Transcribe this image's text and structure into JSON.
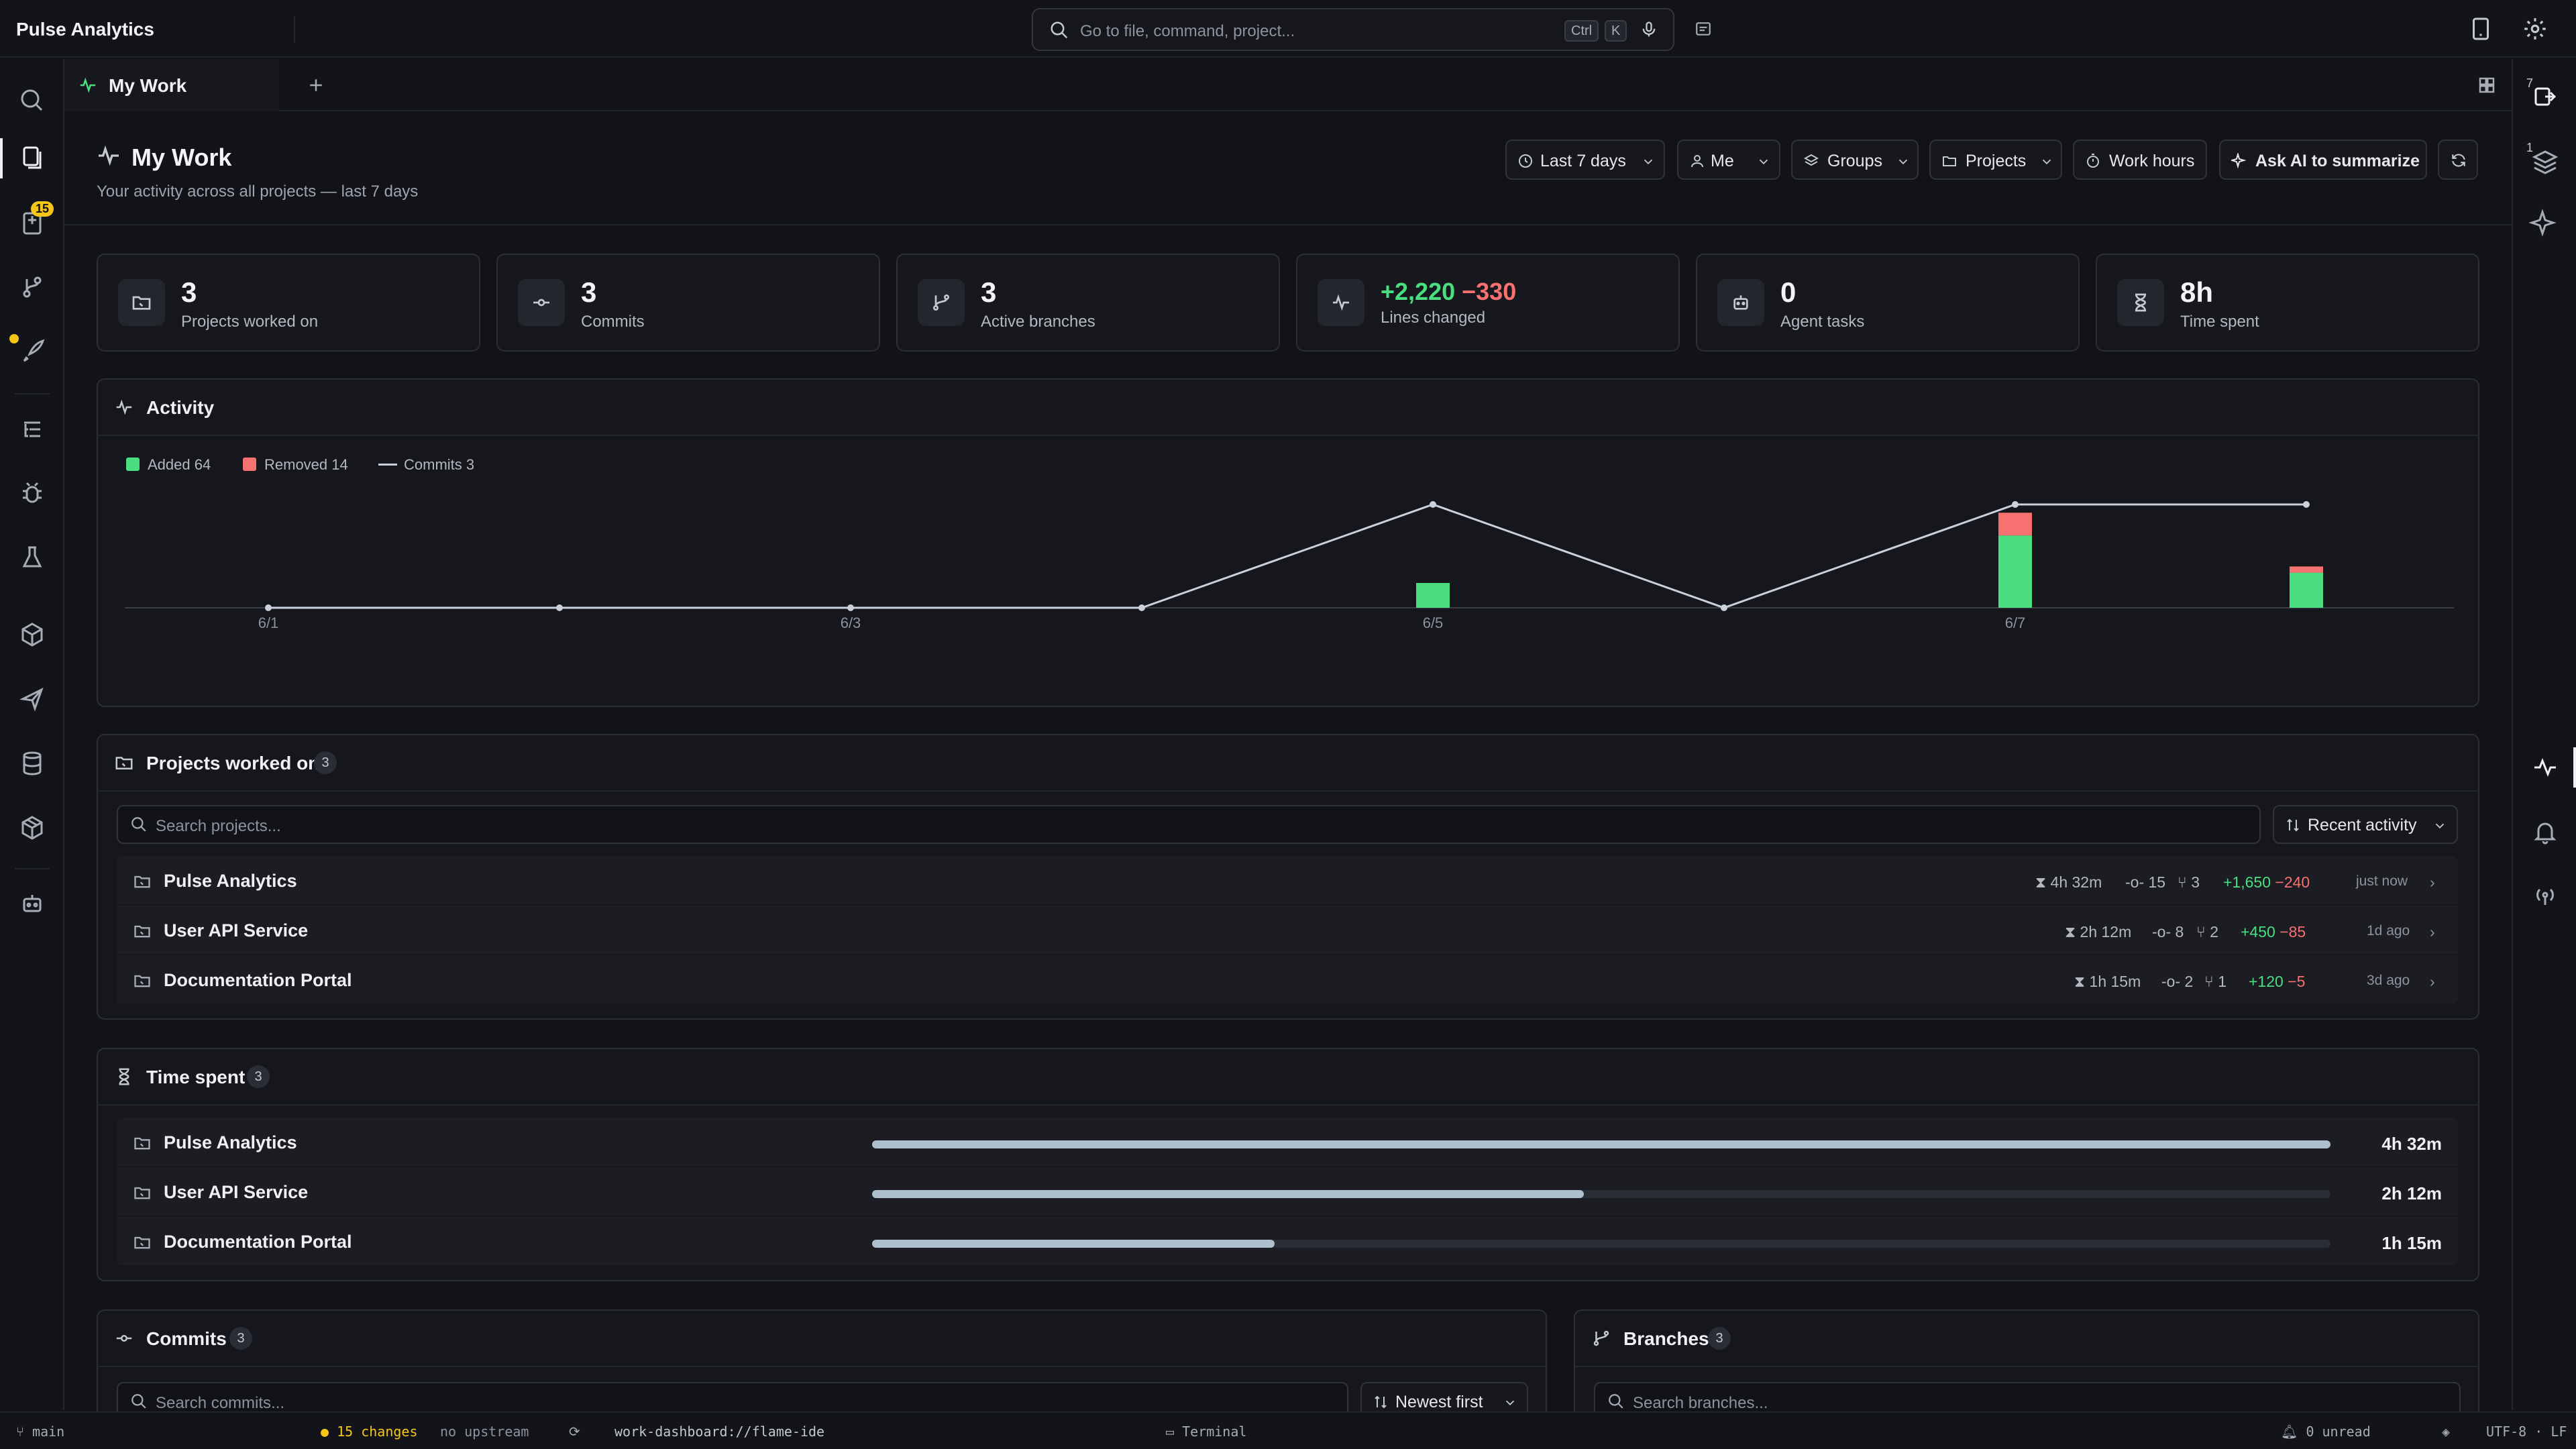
{
  "app": {
    "title": "Pulse Analytics"
  },
  "command_bar": {
    "placeholder": "Go to file, command, project...",
    "shortcut_ctrl": "Ctrl",
    "shortcut_key": "K"
  },
  "activity_bar": {
    "badge": "15",
    "right_badges": [
      "7",
      "1"
    ]
  },
  "tabs": [
    {
      "label": "My Work"
    }
  ],
  "page": {
    "title": "My Work",
    "subtitle": "Your activity across all projects — last 7 days",
    "filters": {
      "range": "Last 7 days",
      "user": "Me",
      "groups": "Groups",
      "projects": "Projects",
      "work_hours": "Work hours",
      "ai": "Ask AI to summarize"
    }
  },
  "stats": [
    {
      "value": "3",
      "label": "Projects worked on",
      "icon": "folder-icon"
    },
    {
      "value": "3",
      "label": "Commits",
      "icon": "commit-icon"
    },
    {
      "value": "3",
      "label": "Active branches",
      "icon": "branch-icon"
    },
    {
      "value_added": "+2,220",
      "value_removed": "−330",
      "label": "Lines changed",
      "icon": "pulse-icon"
    },
    {
      "value": "0",
      "label": "Agent tasks",
      "icon": "robot-icon"
    },
    {
      "value": "8h",
      "label": "Time spent",
      "icon": "hourglass-icon"
    }
  ],
  "activity": {
    "title": "Activity",
    "legend": {
      "added": "Added 64",
      "removed": "Removed 14",
      "commits": "Commits 3"
    }
  },
  "chart_data": {
    "type": "bar",
    "x": [
      "6/1",
      "6/2",
      "6/3",
      "6/4",
      "6/5",
      "6/6",
      "6/7",
      "6/8"
    ],
    "tick_labels": [
      "6/1",
      "6/3",
      "6/5",
      "6/7"
    ],
    "series": [
      {
        "name": "Added",
        "values": [
          0,
          0,
          0,
          0,
          12,
          0,
          35,
          17
        ],
        "color": "#4ade80"
      },
      {
        "name": "Removed",
        "values": [
          0,
          0,
          0,
          0,
          0,
          0,
          11,
          3
        ],
        "color": "#f87171"
      },
      {
        "name": "Commits",
        "type": "line",
        "values": [
          0,
          0,
          0,
          0,
          1,
          0,
          1,
          1
        ],
        "color": "#c9d2dc"
      }
    ],
    "ylim": [
      0,
      50
    ],
    "grid": false,
    "legend_position": "top-left"
  },
  "projects": {
    "title": "Projects worked on",
    "count": "3",
    "search_placeholder": "Search projects...",
    "sort": "Recent activity",
    "rows": [
      {
        "name": "Pulse Analytics",
        "time": "4h 32m",
        "commits": "15",
        "branches": "3",
        "added": "+1,650",
        "removed": "−240",
        "when": "just now"
      },
      {
        "name": "User API Service",
        "time": "2h 12m",
        "commits": "8",
        "branches": "2",
        "added": "+450",
        "removed": "−85",
        "when": "1d ago"
      },
      {
        "name": "Documentation Portal",
        "time": "1h 15m",
        "commits": "2",
        "branches": "1",
        "added": "+120",
        "removed": "−5",
        "when": "3d ago"
      }
    ]
  },
  "time_spent": {
    "title": "Time spent",
    "count": "3",
    "rows": [
      {
        "name": "Pulse Analytics",
        "time": "4h 32m",
        "fraction": 1.0
      },
      {
        "name": "User API Service",
        "time": "2h 12m",
        "fraction": 0.488
      },
      {
        "name": "Documentation Portal",
        "time": "1h 15m",
        "fraction": 0.276
      }
    ]
  },
  "commits": {
    "title": "Commits",
    "count": "3",
    "search_placeholder": "Search commits...",
    "sort": "Newest first"
  },
  "branches": {
    "title": "Branches",
    "count": "3",
    "search_placeholder": "Search branches..."
  },
  "statusbar": {
    "branch": "main",
    "changes": "15 changes",
    "upstream": "no upstream",
    "path": "work-dashboard://flame-ide",
    "terminal": "Terminal",
    "notifications": "0 unread",
    "encoding": "UTF-8 · LF"
  },
  "colors": {
    "accent_green": "#4ade80",
    "accent_red": "#f87171",
    "badge_yellow": "#f5c518",
    "background": "#111318"
  }
}
